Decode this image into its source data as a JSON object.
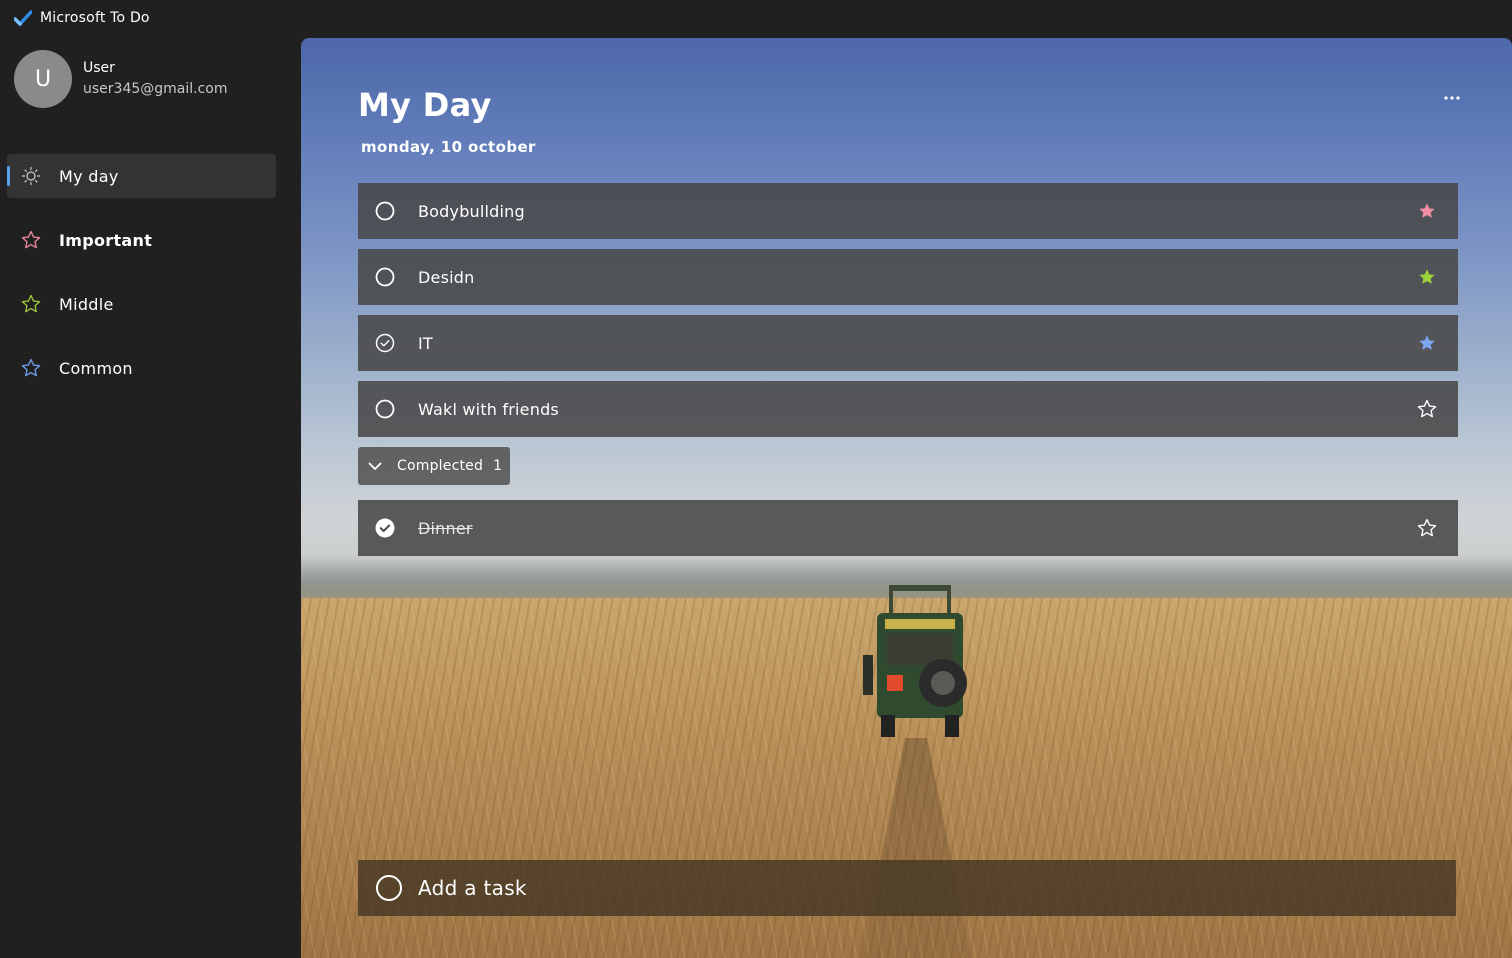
{
  "app": {
    "title": "Microsoft To Do",
    "logo_icon": "checkmark-logo-icon"
  },
  "profile": {
    "initial": "U",
    "name": "User",
    "email": "user345@gmail.com"
  },
  "sidebar": {
    "items": [
      {
        "label": "My day",
        "icon": "sun-icon",
        "active": true
      },
      {
        "label": "Important",
        "icon": "star-outline-icon",
        "icon_color": "#e8839a"
      },
      {
        "label": "Middle",
        "icon": "star-outline-icon",
        "icon_color": "#9bc53d"
      },
      {
        "label": "Common",
        "icon": "star-outline-icon",
        "icon_color": "#6e9be8"
      }
    ]
  },
  "main": {
    "title": "My Day",
    "date": "monday, 10 october",
    "more_label": "...",
    "tasks": [
      {
        "label": "Bodybullding",
        "state": "open",
        "star": "filled",
        "star_color": "#f08ea2"
      },
      {
        "label": "Desidn",
        "state": "open",
        "star": "filled",
        "star_color": "#9bd03a"
      },
      {
        "label": "IT",
        "state": "in-progress",
        "star": "filled",
        "star_color": "#7aa6f0"
      },
      {
        "label": "Wakl with friends",
        "state": "open",
        "star": "outline",
        "star_color": "#ffffff"
      }
    ],
    "completed": {
      "label": "Complected",
      "count": "1",
      "tasks": [
        {
          "label": "Dinner",
          "state": "done",
          "star": "outline",
          "star_color": "#ffffff"
        }
      ]
    },
    "add_task": {
      "label": "Add a task"
    }
  },
  "colors": {
    "sidebar_bg": "#202020",
    "active_indicator": "#5aa0ee",
    "task_row_bg": "#484848"
  }
}
